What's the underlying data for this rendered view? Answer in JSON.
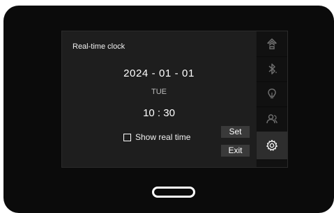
{
  "panel": {
    "title": "Real-time clock",
    "date": "2024 - 01 - 01",
    "weekday": "TUE",
    "time": "10 : 30",
    "show_real_time": {
      "label": "Show real time",
      "checked": false
    },
    "set_label": "Set",
    "exit_label": "Exit"
  },
  "sidebar": {
    "items": [
      {
        "icon": "network-icon",
        "active": false
      },
      {
        "icon": "bluetooth-icon",
        "active": false
      },
      {
        "icon": "lightbulb-icon",
        "active": false
      },
      {
        "icon": "user-icon",
        "active": false
      },
      {
        "icon": "gear-icon",
        "active": true
      }
    ]
  },
  "colors": {
    "device_body": "#0b0b0b",
    "panel_bg": "#1e1e1e",
    "sidebar_bg": "#111111",
    "button_bg": "#3a3a3a",
    "icon_dim": "#6e6e6e",
    "icon_active": "#ffffff"
  }
}
